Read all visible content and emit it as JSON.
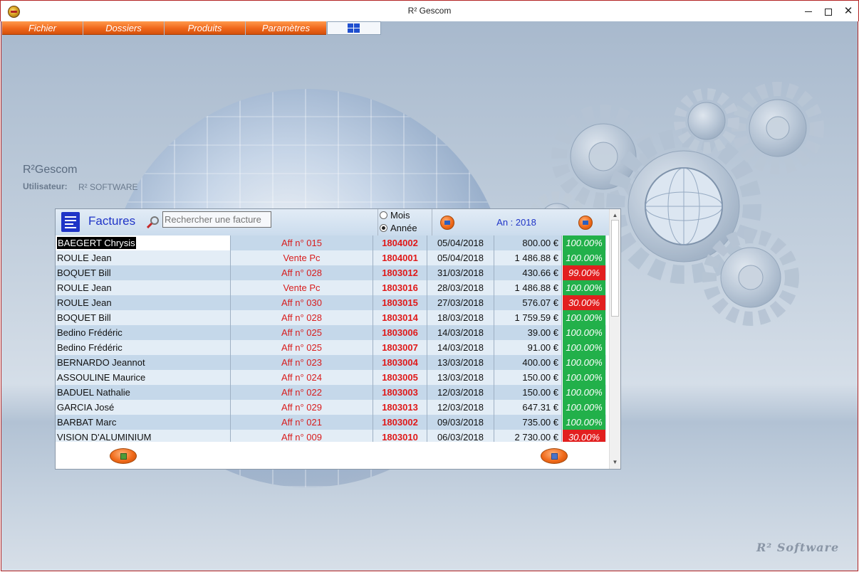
{
  "window": {
    "title": "R² Gescom"
  },
  "menu": {
    "items": [
      "Fichier",
      "Dossiers",
      "Produits",
      "Paramètres"
    ]
  },
  "info": {
    "app_name": "R²Gescom",
    "user_label": "Utilisateur:",
    "user_value": "R² SOFTWARE"
  },
  "brand": "R² Software",
  "panel": {
    "title": "Factures",
    "search_placeholder": "Rechercher une facture",
    "radio_mois": "Mois",
    "radio_annee": "Année",
    "radio_selected": "Année",
    "year_label": "An : 2018"
  },
  "invoices": [
    {
      "client": "BAEGERT Chrysis",
      "affaire": "Aff n° 015",
      "numero": "1804002",
      "date": "05/04/2018",
      "montant": "800.00 €",
      "pct": "100.00%",
      "status": "paid"
    },
    {
      "client": "ROULE Jean",
      "affaire": "Vente Pc",
      "numero": "1804001",
      "date": "05/04/2018",
      "montant": "1 486.88 €",
      "pct": "100.00%",
      "status": "paid"
    },
    {
      "client": "BOQUET Bill",
      "affaire": "Aff n° 028",
      "numero": "1803012",
      "date": "31/03/2018",
      "montant": "430.66 €",
      "pct": "99.00%",
      "status": "partial"
    },
    {
      "client": "ROULE Jean",
      "affaire": "Vente Pc",
      "numero": "1803016",
      "date": "28/03/2018",
      "montant": "1 486.88 €",
      "pct": "100.00%",
      "status": "paid"
    },
    {
      "client": "ROULE Jean",
      "affaire": "Aff n° 030",
      "numero": "1803015",
      "date": "27/03/2018",
      "montant": "576.07 €",
      "pct": "30.00%",
      "status": "partial"
    },
    {
      "client": "BOQUET Bill",
      "affaire": "Aff n° 028",
      "numero": "1803014",
      "date": "18/03/2018",
      "montant": "1 759.59 €",
      "pct": "100.00%",
      "status": "paid"
    },
    {
      "client": "Bedino Frédéric",
      "affaire": "Aff n° 025",
      "numero": "1803006",
      "date": "14/03/2018",
      "montant": "39.00 €",
      "pct": "100.00%",
      "status": "paid"
    },
    {
      "client": "Bedino Frédéric",
      "affaire": "Aff n° 025",
      "numero": "1803007",
      "date": "14/03/2018",
      "montant": "91.00 €",
      "pct": "100.00%",
      "status": "paid"
    },
    {
      "client": "BERNARDO Jeannot",
      "affaire": "Aff n° 023",
      "numero": "1803004",
      "date": "13/03/2018",
      "montant": "400.00 €",
      "pct": "100.00%",
      "status": "paid"
    },
    {
      "client": "ASSOULINE Maurice",
      "affaire": "Aff n° 024",
      "numero": "1803005",
      "date": "13/03/2018",
      "montant": "150.00 €",
      "pct": "100.00%",
      "status": "paid"
    },
    {
      "client": "BADUEL Nathalie",
      "affaire": "Aff n° 022",
      "numero": "1803003",
      "date": "12/03/2018",
      "montant": "150.00 €",
      "pct": "100.00%",
      "status": "paid"
    },
    {
      "client": "GARCIA José",
      "affaire": "Aff n° 029",
      "numero": "1803013",
      "date": "12/03/2018",
      "montant": "647.31 €",
      "pct": "100.00%",
      "status": "paid"
    },
    {
      "client": "BARBAT Marc",
      "affaire": "Aff n° 021",
      "numero": "1803002",
      "date": "09/03/2018",
      "montant": "735.00 €",
      "pct": "100.00%",
      "status": "paid"
    },
    {
      "client": "VISION D'ALUMINIUM",
      "affaire": "Aff n° 009",
      "numero": "1803010",
      "date": "06/03/2018",
      "montant": "2 730.00 €",
      "pct": "30.00%",
      "status": "partial"
    }
  ],
  "colors": {
    "menu_orange": "#f0671b",
    "paid_green": "#22b04a",
    "partial_red": "#e21f1f",
    "title_blue": "#1f34c7",
    "ref_red": "#d81d1d"
  },
  "icons": {
    "app": "gescom-logo-icon",
    "factures": "invoice-list-icon",
    "search": "search-icon",
    "prev": "arrow-left-icon",
    "next": "arrow-right-icon",
    "window_menu": "windows-logo-icon",
    "footer_left": "new-invoice-icon",
    "footer_right": "exit-icon"
  }
}
